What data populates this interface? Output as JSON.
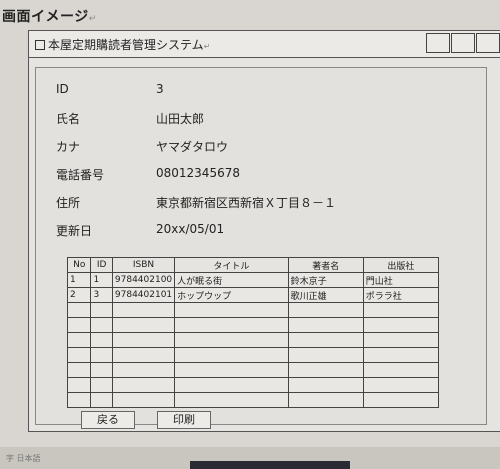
{
  "heading": {
    "text": "画面イメージ",
    "mark": "↵"
  },
  "window": {
    "title": "本屋定期購読者管理システム",
    "title_mark": "↵"
  },
  "fields": [
    {
      "label": "ID",
      "value": "3"
    },
    {
      "label": "氏名",
      "value": "山田太郎"
    },
    {
      "label": "カナ",
      "value": "ヤマダタロウ"
    },
    {
      "label": "電話番号",
      "value": "08012345678"
    },
    {
      "label": "住所",
      "value": "東京都新宿区西新宿Ｘ丁目８－１"
    },
    {
      "label": "更新日",
      "value": "20xx/05/01"
    }
  ],
  "table": {
    "headers": [
      "No",
      "ID",
      "ISBN",
      "タイトル",
      "著者名",
      "出版社"
    ],
    "rows": [
      [
        "1",
        "1",
        "9784402100",
        "人が眠る街",
        "鈴木京子",
        "門山社"
      ],
      [
        "2",
        "3",
        "9784402101",
        "ホップウップ",
        "歌川正雄",
        "ポララ社"
      ]
    ]
  },
  "buttons": {
    "back": "戻る",
    "print": "印刷"
  },
  "taskbar": {
    "text": "字 日本語"
  }
}
